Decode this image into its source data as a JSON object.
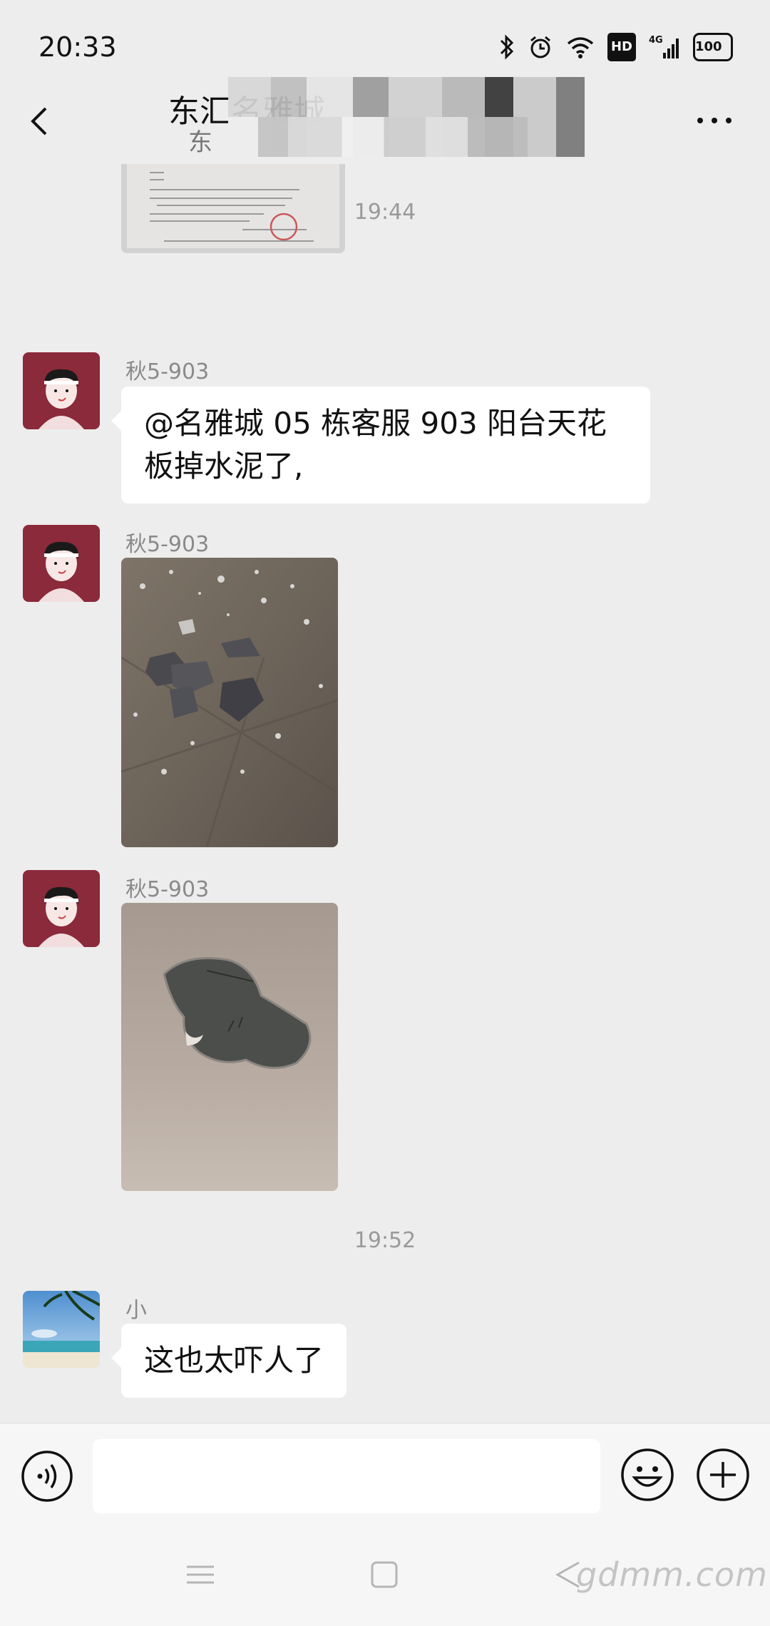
{
  "status_bar": {
    "time": "20:33",
    "hd_label": "HD",
    "network_label": "4G",
    "battery_label": "100",
    "icons": [
      "bluetooth-icon",
      "alarm-icon",
      "wifi-icon",
      "hd-icon",
      "signal-icon",
      "battery-icon"
    ]
  },
  "header": {
    "title": "东汇名雅城",
    "subtitle": "东"
  },
  "messages": [
    {
      "type": "timestamp",
      "text": "19:44"
    },
    {
      "type": "text",
      "sender": "秋5-903",
      "text_line1": "@名雅城 05 栋客服  903 阳台天花",
      "text_line2": "板掉水泥了,"
    },
    {
      "type": "image",
      "sender": "秋5-903"
    },
    {
      "type": "image",
      "sender": "秋5-903"
    },
    {
      "type": "timestamp",
      "text": "19:52"
    },
    {
      "type": "text",
      "sender": "小",
      "text": "这也太吓人了"
    }
  ],
  "input": {
    "placeholder": ""
  },
  "watermark": "gdmm.com",
  "colors": {
    "background": "#ededed",
    "bubble": "#ffffff",
    "avatar_red": "#8a2a3a"
  }
}
